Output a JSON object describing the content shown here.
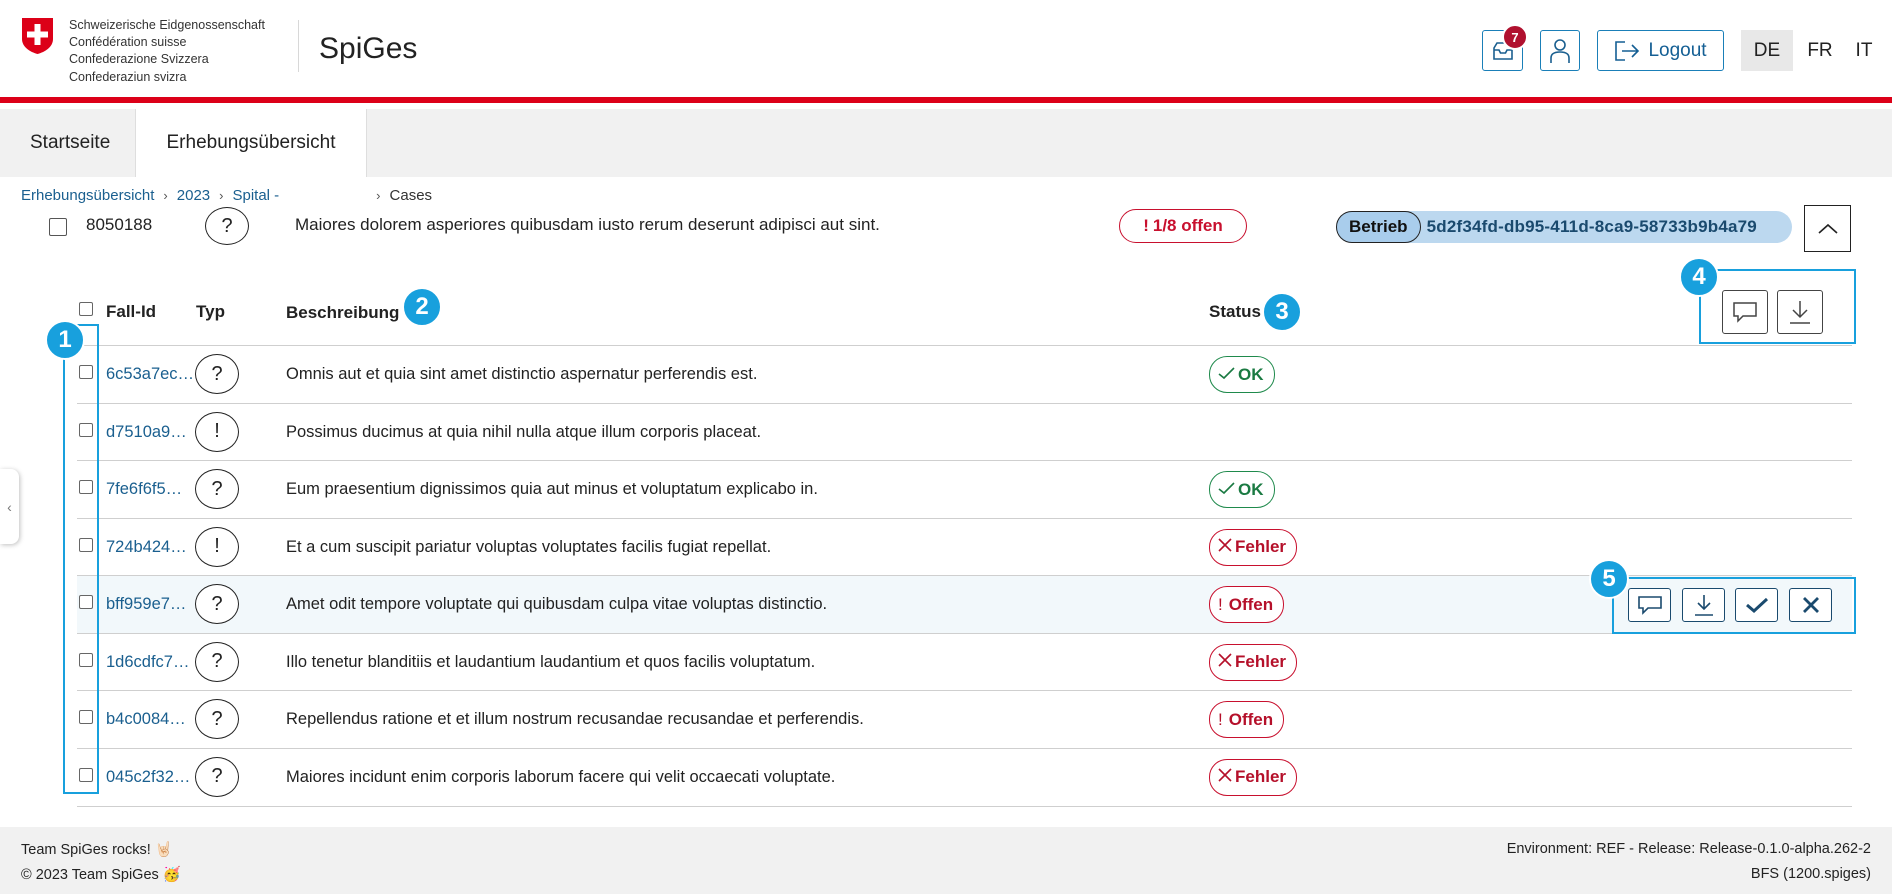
{
  "header": {
    "confederation_lines": [
      "Schweizerische Eidgenossenschaft",
      "Confédération suisse",
      "Confederazione Svizzera",
      "Confederaziun svizra"
    ],
    "app_title": "SpiGes",
    "notification_count": "7",
    "logout_label": "Logout",
    "languages": [
      {
        "code": "DE",
        "active": true
      },
      {
        "code": "FR",
        "active": false
      },
      {
        "code": "IT",
        "active": false
      }
    ],
    "accent_color": "#dc0018"
  },
  "nav": {
    "tabs": [
      {
        "label": "Startseite",
        "active": false
      },
      {
        "label": "Erhebungsübersicht",
        "active": true
      }
    ]
  },
  "breadcrumb": {
    "items": [
      "Erhebungsübersicht",
      "2023",
      "Spital -"
    ],
    "current": "Cases"
  },
  "summary": {
    "id": "8050188",
    "typ_icon": "question",
    "description": "Maiores dolorem asperiores quibusdam iusto rerum deserunt adipisci aut sint.",
    "status": "1/8 offen",
    "betrieb_label": "Betrieb",
    "betrieb_id": "5d2f34fd-db95-411d-8ca9-58733b9b4a79"
  },
  "table": {
    "headers": {
      "fall_id": "Fall-Id",
      "typ": "Typ",
      "beschreibung": "Beschreibung",
      "status": "Status"
    },
    "rows": [
      {
        "id": "6c53a7ec…",
        "typ": "?",
        "desc": "Omnis aut et quia sint amet distinctio aspernatur perferendis est.",
        "status": "OK",
        "status_kind": "ok"
      },
      {
        "id": "d7510a9…",
        "typ": "!",
        "desc": "Possimus ducimus at quia nihil nulla atque illum corporis placeat.",
        "status": "",
        "status_kind": "none"
      },
      {
        "id": "7fe6f6f5…",
        "typ": "?",
        "desc": "Eum praesentium dignissimos quia aut minus et voluptatum explicabo in.",
        "status": "OK",
        "status_kind": "ok"
      },
      {
        "id": "724b424…",
        "typ": "!",
        "desc": "Et a cum suscipit pariatur voluptas voluptates facilis fugiat repellat.",
        "status": "Fehler",
        "status_kind": "error"
      },
      {
        "id": "bff959e7…",
        "typ": "?",
        "desc": "Amet odit tempore voluptate qui quibusdam culpa vitae voluptas distinctio.",
        "status": "Offen",
        "status_kind": "open"
      },
      {
        "id": "1d6cdfc7…",
        "typ": "?",
        "desc": "Illo tenetur blanditiis et laudantium laudantium et quos facilis voluptatum.",
        "status": "Fehler",
        "status_kind": "error"
      },
      {
        "id": "b4c0084…",
        "typ": "?",
        "desc": "Repellendus ratione et et illum nostrum recusandae recusandae et perferendis.",
        "status": "Offen",
        "status_kind": "open"
      },
      {
        "id": "045c2f32…",
        "typ": "?",
        "desc": "Maiores incidunt enim corporis laborum facere qui velit occaecati voluptate.",
        "status": "Fehler",
        "status_kind": "error"
      }
    ],
    "highlighted_row": 4
  },
  "annotations": [
    "1",
    "2",
    "3",
    "4",
    "5"
  ],
  "footer": {
    "left_line1": "Team SpiGes rocks! 🤘🏻",
    "left_line2": "© 2023 Team SpiGes 🥳",
    "right_line1": "Environment: REF - Release: Release-0.1.0-alpha.262-2",
    "right_line2": "BFS (1200.spiges)"
  },
  "icons": {
    "header": [
      "swiss-flag-icon",
      "inbox-icon",
      "user-icon",
      "logout-icon"
    ],
    "actions": [
      "comment-icon",
      "download-icon",
      "check-icon",
      "close-icon"
    ]
  }
}
